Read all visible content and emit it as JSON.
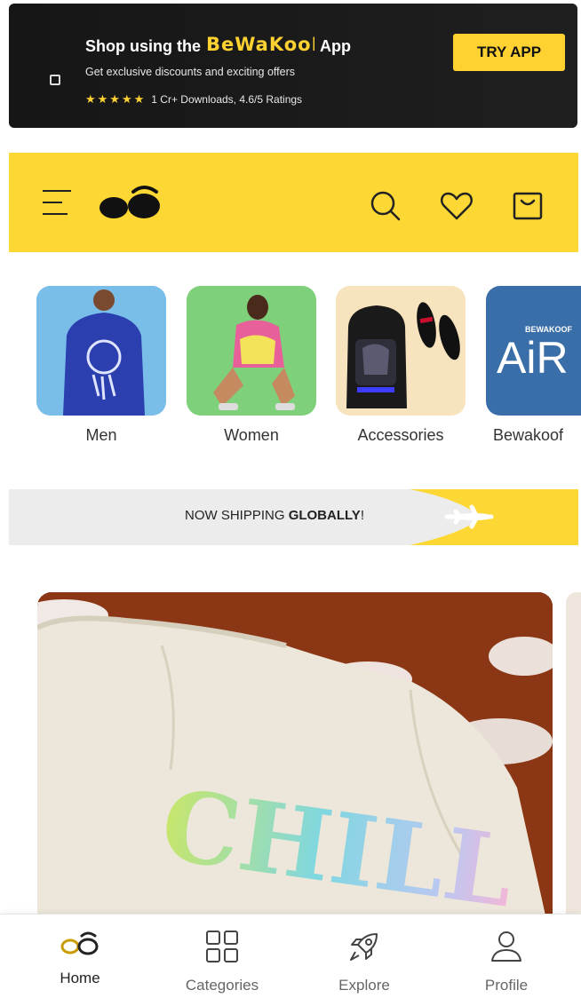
{
  "app_banner": {
    "headline_prefix": "Shop using the",
    "brand": "Bewakoof",
    "headline_suffix": "App",
    "subtitle": "Get exclusive discounts and exciting offers",
    "stars": "★★★★★",
    "rating_text": "1 Cr+ Downloads, 4.6/5 Ratings",
    "cta_label": "TRY APP",
    "accent_color": "#ffd232"
  },
  "header": {
    "background_color": "#fdd835",
    "icons": [
      "menu-icon",
      "bewakoof-logo",
      "search-icon",
      "wishlist-heart-icon",
      "bag-icon"
    ]
  },
  "categories": [
    {
      "label": "Men"
    },
    {
      "label": "Women"
    },
    {
      "label": "Accessories"
    },
    {
      "label": "Bewakoof"
    }
  ],
  "shipping": {
    "prefix": "NOW SHIPPING ",
    "bold": "GLOBALLY",
    "suffix": "!"
  },
  "hero": {
    "graphic_text": "CHILL"
  },
  "bottom_nav": [
    {
      "label": "Home",
      "icon": "home-logo-icon",
      "active": true
    },
    {
      "label": "Categories",
      "icon": "categories-grid-icon",
      "active": false
    },
    {
      "label": "Explore",
      "icon": "rocket-icon",
      "active": false
    },
    {
      "label": "Profile",
      "icon": "profile-icon",
      "active": false
    }
  ]
}
